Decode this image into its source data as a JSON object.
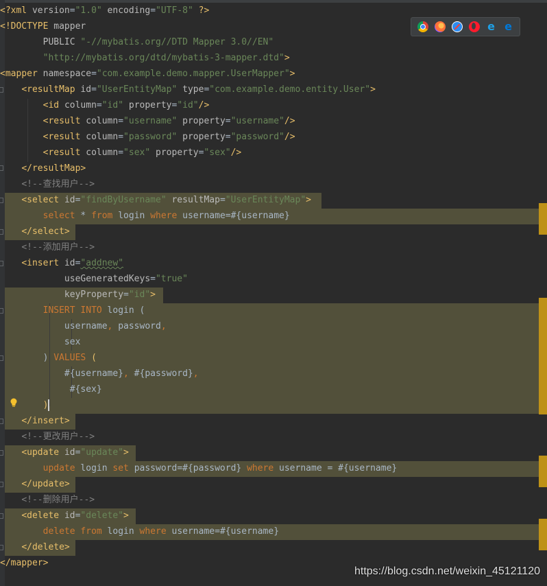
{
  "colors": {
    "background": "#2b2b2b",
    "keyword": "#cc7832",
    "tag": "#e8bf6a",
    "attribute": "#bababa",
    "string": "#6a8759",
    "comment": "#808080",
    "text": "#a9b7c6",
    "highlight_band": "#52503a",
    "scroll_marker": "#be9117"
  },
  "toolbar": {
    "browsers": [
      "chrome-icon",
      "firefox-icon",
      "safari-icon",
      "opera-icon",
      "internet-explorer-icon",
      "edge-icon"
    ]
  },
  "code": {
    "lines": [
      [
        {
          "t": "pi",
          "v": "<?xml "
        },
        {
          "t": "attr",
          "v": "version"
        },
        {
          "t": "txt",
          "v": "="
        },
        {
          "t": "str",
          "v": "\"1.0\""
        },
        {
          "t": "attr",
          "v": " encoding"
        },
        {
          "t": "txt",
          "v": "="
        },
        {
          "t": "str",
          "v": "\"UTF-8\""
        },
        {
          "t": "pi",
          "v": " ?>"
        }
      ],
      [
        {
          "t": "dt",
          "v": "<!DOCTYPE "
        },
        {
          "t": "attr",
          "v": "mapper"
        }
      ],
      [
        {
          "t": "txt",
          "v": "        "
        },
        {
          "t": "attr",
          "v": "PUBLIC "
        },
        {
          "t": "str",
          "v": "\"-//mybatis.org//DTD Mapper 3.0//EN\""
        }
      ],
      [
        {
          "t": "txt",
          "v": "        "
        },
        {
          "t": "str",
          "v": "\"http://mybatis.org/dtd/mybatis-3-mapper.dtd\""
        },
        {
          "t": "dt",
          "v": ">"
        }
      ],
      [
        {
          "t": "tag",
          "v": "<mapper "
        },
        {
          "t": "attr",
          "v": "namespace"
        },
        {
          "t": "txt",
          "v": "="
        },
        {
          "t": "str",
          "v": "\"com.example.demo.mapper.UserMapper\""
        },
        {
          "t": "tag",
          "v": ">"
        }
      ],
      [
        {
          "t": "txt",
          "v": "    "
        },
        {
          "t": "tag",
          "v": "<resultMap "
        },
        {
          "t": "attr",
          "v": "id"
        },
        {
          "t": "txt",
          "v": "="
        },
        {
          "t": "str",
          "v": "\"UserEntityMap\""
        },
        {
          "t": "attr",
          "v": " type"
        },
        {
          "t": "txt",
          "v": "="
        },
        {
          "t": "str",
          "v": "\"com.example.demo.entity.User\""
        },
        {
          "t": "tag",
          "v": ">"
        }
      ],
      [
        {
          "t": "txt",
          "v": "        "
        },
        {
          "t": "tag",
          "v": "<id "
        },
        {
          "t": "attr",
          "v": "column"
        },
        {
          "t": "txt",
          "v": "="
        },
        {
          "t": "str",
          "v": "\"id\""
        },
        {
          "t": "attr",
          "v": " property"
        },
        {
          "t": "txt",
          "v": "="
        },
        {
          "t": "str",
          "v": "\"id\""
        },
        {
          "t": "tag",
          "v": "/>"
        }
      ],
      [
        {
          "t": "txt",
          "v": "        "
        },
        {
          "t": "tag",
          "v": "<result "
        },
        {
          "t": "attr",
          "v": "column"
        },
        {
          "t": "txt",
          "v": "="
        },
        {
          "t": "str",
          "v": "\"username\""
        },
        {
          "t": "attr",
          "v": " property"
        },
        {
          "t": "txt",
          "v": "="
        },
        {
          "t": "str",
          "v": "\"username\""
        },
        {
          "t": "tag",
          "v": "/>"
        }
      ],
      [
        {
          "t": "txt",
          "v": "        "
        },
        {
          "t": "tag",
          "v": "<result "
        },
        {
          "t": "attr",
          "v": "column"
        },
        {
          "t": "txt",
          "v": "="
        },
        {
          "t": "str",
          "v": "\"password\""
        },
        {
          "t": "attr",
          "v": " property"
        },
        {
          "t": "txt",
          "v": "="
        },
        {
          "t": "str",
          "v": "\"password\""
        },
        {
          "t": "tag",
          "v": "/>"
        }
      ],
      [
        {
          "t": "txt",
          "v": "        "
        },
        {
          "t": "tag",
          "v": "<result "
        },
        {
          "t": "attr",
          "v": "column"
        },
        {
          "t": "txt",
          "v": "="
        },
        {
          "t": "str",
          "v": "\"sex\""
        },
        {
          "t": "attr",
          "v": " property"
        },
        {
          "t": "txt",
          "v": "="
        },
        {
          "t": "str",
          "v": "\"sex\""
        },
        {
          "t": "tag",
          "v": "/>"
        }
      ],
      [
        {
          "t": "txt",
          "v": "    "
        },
        {
          "t": "tag",
          "v": "</resultMap>"
        }
      ],
      [
        {
          "t": "txt",
          "v": "    "
        },
        {
          "t": "cmt",
          "v": "<!--查找用户-->"
        }
      ],
      [
        {
          "t": "txt",
          "v": "    "
        },
        {
          "t": "tag",
          "v": "<select "
        },
        {
          "t": "attr",
          "v": "id"
        },
        {
          "t": "txt",
          "v": "="
        },
        {
          "t": "str",
          "v": "\"findByUsername\""
        },
        {
          "t": "attr",
          "v": " resultMap"
        },
        {
          "t": "txt",
          "v": "="
        },
        {
          "t": "str",
          "v": "\"UserEntityMap\""
        },
        {
          "t": "tag",
          "v": ">"
        }
      ],
      [
        {
          "t": "txt",
          "v": "        "
        },
        {
          "t": "kw",
          "v": "select"
        },
        {
          "t": "txt",
          "v": " * "
        },
        {
          "t": "kw",
          "v": "from"
        },
        {
          "t": "txt",
          "v": " login "
        },
        {
          "t": "kw",
          "v": "where"
        },
        {
          "t": "txt",
          "v": " username=#{username}"
        }
      ],
      [
        {
          "t": "txt",
          "v": "    "
        },
        {
          "t": "tag",
          "v": "</select>"
        }
      ],
      [
        {
          "t": "txt",
          "v": "    "
        },
        {
          "t": "cmt",
          "v": "<!--添加用户-->"
        }
      ],
      [
        {
          "t": "txt",
          "v": "    "
        },
        {
          "t": "tag",
          "v": "<insert "
        },
        {
          "t": "attr",
          "v": "id"
        },
        {
          "t": "txt",
          "v": "="
        },
        {
          "t": "strw",
          "v": "\"addnew\""
        }
      ],
      [
        {
          "t": "txt",
          "v": "            "
        },
        {
          "t": "attr",
          "v": "useGeneratedKeys"
        },
        {
          "t": "txt",
          "v": "="
        },
        {
          "t": "str",
          "v": "\"true\""
        }
      ],
      [
        {
          "t": "txt",
          "v": "            "
        },
        {
          "t": "attr",
          "v": "keyProperty"
        },
        {
          "t": "txt",
          "v": "="
        },
        {
          "t": "str",
          "v": "\"id\""
        },
        {
          "t": "tag",
          "v": ">"
        }
      ],
      [
        {
          "t": "txt",
          "v": "        "
        },
        {
          "t": "kw",
          "v": "INSERT INTO"
        },
        {
          "t": "txt",
          "v": " login ("
        }
      ],
      [
        {
          "t": "txt",
          "v": "            username"
        },
        {
          "t": "kw",
          "v": ","
        },
        {
          "t": "txt",
          "v": " password"
        },
        {
          "t": "kw",
          "v": ","
        }
      ],
      [
        {
          "t": "txt",
          "v": "            sex"
        }
      ],
      [
        {
          "t": "txt",
          "v": "        ) "
        },
        {
          "t": "kw",
          "v": "VALUES"
        },
        {
          "t": "txt",
          "v": " "
        },
        {
          "t": "brace",
          "v": "("
        }
      ],
      [
        {
          "t": "txt",
          "v": "            #{username}"
        },
        {
          "t": "kw",
          "v": ","
        },
        {
          "t": "txt",
          "v": " #{password}"
        },
        {
          "t": "kw",
          "v": ","
        }
      ],
      [
        {
          "t": "txt",
          "v": "             #{sex}"
        }
      ],
      [
        {
          "t": "txt",
          "v": "        "
        },
        {
          "t": "brace",
          "v": ")"
        },
        {
          "t": "caret",
          "v": ""
        }
      ],
      [
        {
          "t": "txt",
          "v": "    "
        },
        {
          "t": "tag",
          "v": "</insert>"
        }
      ],
      [
        {
          "t": "txt",
          "v": "    "
        },
        {
          "t": "cmt",
          "v": "<!--更改用户-->"
        }
      ],
      [
        {
          "t": "txt",
          "v": "    "
        },
        {
          "t": "tag",
          "v": "<update "
        },
        {
          "t": "attr",
          "v": "id"
        },
        {
          "t": "txt",
          "v": "="
        },
        {
          "t": "str",
          "v": "\"update\""
        },
        {
          "t": "tag",
          "v": ">"
        }
      ],
      [
        {
          "t": "txt",
          "v": "        "
        },
        {
          "t": "kw",
          "v": "update"
        },
        {
          "t": "txt",
          "v": " login "
        },
        {
          "t": "kw",
          "v": "set"
        },
        {
          "t": "txt",
          "v": " password=#{password} "
        },
        {
          "t": "kw",
          "v": "where"
        },
        {
          "t": "txt",
          "v": " username = #{username}"
        }
      ],
      [
        {
          "t": "txt",
          "v": "    "
        },
        {
          "t": "tag",
          "v": "</update>"
        }
      ],
      [
        {
          "t": "txt",
          "v": "    "
        },
        {
          "t": "cmt",
          "v": "<!--删除用户-->"
        }
      ],
      [
        {
          "t": "txt",
          "v": "    "
        },
        {
          "t": "tag",
          "v": "<delete "
        },
        {
          "t": "attr",
          "v": "id"
        },
        {
          "t": "txt",
          "v": "="
        },
        {
          "t": "str",
          "v": "\"delete\""
        },
        {
          "t": "tag",
          "v": ">"
        }
      ],
      [
        {
          "t": "txt",
          "v": "        "
        },
        {
          "t": "kw",
          "v": "delete"
        },
        {
          "t": "txt",
          "v": " "
        },
        {
          "t": "kw",
          "v": "from"
        },
        {
          "t": "txt",
          "v": " login "
        },
        {
          "t": "kw",
          "v": "where"
        },
        {
          "t": "txt",
          "v": " username=#{username}"
        }
      ],
      [
        {
          "t": "txt",
          "v": "    "
        },
        {
          "t": "tag",
          "v": "</delete>"
        }
      ],
      [
        {
          "t": "tag",
          "v": "</mapper>"
        }
      ]
    ]
  },
  "watermark": "https://blog.csdn.net/weixin_45121120"
}
